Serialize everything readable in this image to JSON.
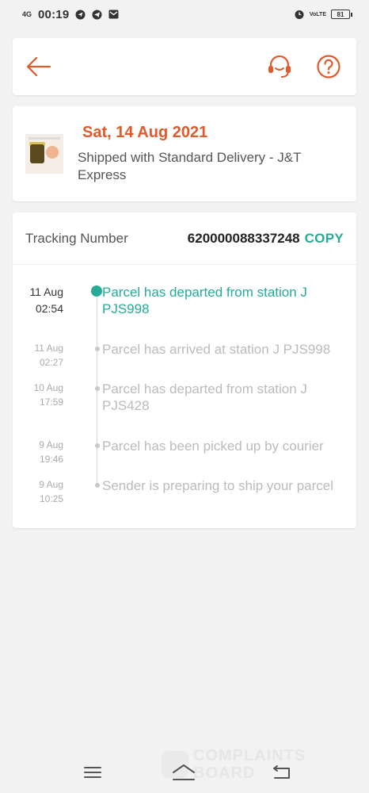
{
  "status_bar": {
    "network": "4G",
    "time": "00:19",
    "battery": "81",
    "volte": "VoLTE"
  },
  "header": {
    "back_icon": "arrow-left-icon",
    "support_icon": "headset-icon",
    "help_icon": "question-circle-icon",
    "accent": "#e05a2b"
  },
  "shipment": {
    "date": "Sat, 14 Aug 2021",
    "description": "Shipped with Standard Delivery  - J&T Express"
  },
  "tracking": {
    "label": "Tracking Number",
    "number": "620000088337248",
    "copy_label": "COPY",
    "accent": "#26aa99",
    "events": [
      {
        "date": "11 Aug",
        "time": "02:54",
        "text": "Parcel has departed from station J PJS998",
        "active": true
      },
      {
        "date": "11 Aug",
        "time": "02:27",
        "text": "Parcel has arrived at station J PJS998",
        "active": false
      },
      {
        "date": "10 Aug",
        "time": "17:59",
        "text": "Parcel has departed from station J PJS428",
        "active": false
      },
      {
        "date": "9 Aug",
        "time": "19:46",
        "text": "Parcel has been picked up by courier",
        "active": false
      },
      {
        "date": "9 Aug",
        "time": "10:25",
        "text": "Sender is preparing to ship your parcel",
        "active": false
      }
    ]
  },
  "navbar": {
    "menu_icon": "menu-icon",
    "home_icon": "home-icon",
    "back_icon": "back-icon"
  },
  "watermark": {
    "text_line1": "COMPLAINTS",
    "text_line2": "BOARD"
  }
}
